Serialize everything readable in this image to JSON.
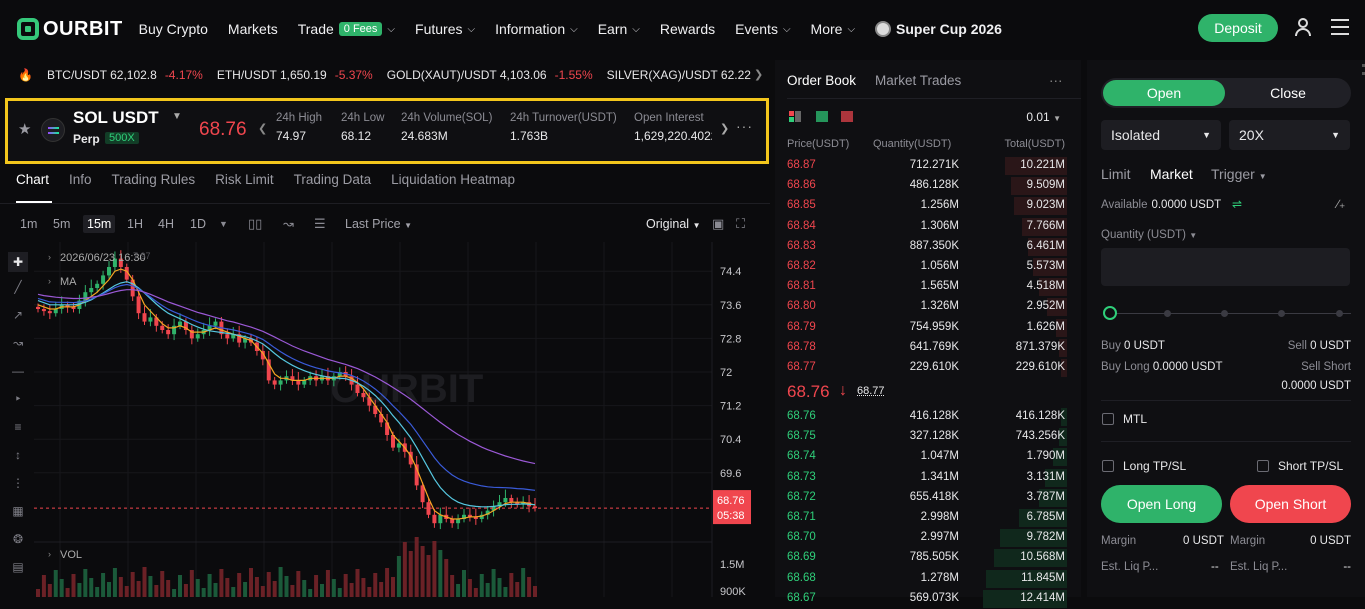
{
  "nav": {
    "brand": "OURBIT",
    "items": [
      "Buy Crypto",
      "Markets",
      "Trade",
      "Futures",
      "Information",
      "Earn",
      "Rewards",
      "Events",
      "More"
    ],
    "fees_badge": "0 Fees",
    "promo": "Super Cup 2026",
    "deposit": "Deposit"
  },
  "ticker": [
    {
      "pair": "BTC/USDT",
      "price": "62,102.8",
      "change": "-4.17%"
    },
    {
      "pair": "ETH/USDT",
      "price": "1,650.19",
      "change": "-5.37%"
    },
    {
      "pair": "GOLD(XAUT)/USDT",
      "price": "4,103.06",
      "change": "-1.55%"
    },
    {
      "pair": "SILVER(XAG)/USDT",
      "price": "62.22",
      "change": ""
    }
  ],
  "symbol": {
    "name": "SOL USDT",
    "type": "Perp",
    "leverage": "500X",
    "last": "68.76",
    "stats": [
      {
        "label": "24h High",
        "value": "74.97"
      },
      {
        "label": "24h Low",
        "value": "68.12"
      },
      {
        "label": "24h Volume(SOL)",
        "value": "24.683M"
      },
      {
        "label": "24h Turnover(USDT)",
        "value": "1.763B"
      },
      {
        "label": "Open Interest",
        "value": "1,629,220.4022"
      }
    ]
  },
  "chart_tabs": [
    "Chart",
    "Info",
    "Trading Rules",
    "Risk Limit",
    "Trading Data",
    "Liquidation Heatmap"
  ],
  "toolbar": {
    "timeframes": [
      "1m",
      "5m",
      "15m",
      "1H",
      "4H",
      "1D"
    ],
    "active_tf": "15m",
    "price_type": "Last Price",
    "view": "Original"
  },
  "chart_data": {
    "type": "candlestick",
    "timestamp_label": "2026/06/23 16:30",
    "timestamp_suffix": "7.97",
    "ma_label": "MA",
    "vol_label": "VOL",
    "price_ticks": [
      "74.4",
      "73.6",
      "72.8",
      "72",
      "71.2",
      "70.4",
      "69.6"
    ],
    "ylim": [
      68.0,
      75.0
    ],
    "vol_ticks": [
      "1.5M",
      "900K"
    ],
    "last_price": "68.76",
    "countdown": "05:38",
    "watermark": "OURBIT",
    "close_series": [
      73.5,
      73.45,
      73.4,
      73.5,
      73.6,
      73.55,
      73.5,
      73.7,
      73.9,
      74.0,
      74.1,
      74.3,
      74.5,
      74.7,
      74.5,
      74.2,
      73.8,
      73.4,
      73.2,
      73.3,
      73.1,
      73.0,
      72.9,
      73.1,
      73.2,
      73.0,
      72.8,
      72.9,
      73.0,
      73.1,
      73.2,
      72.9,
      72.8,
      72.9,
      72.7,
      72.8,
      72.7,
      72.5,
      72.3,
      71.8,
      71.7,
      71.8,
      71.9,
      71.8,
      71.7,
      71.8,
      71.9,
      71.8,
      71.9,
      71.8,
      71.9,
      72.0,
      71.9,
      71.7,
      71.5,
      71.4,
      71.2,
      71.0,
      70.8,
      70.5,
      70.2,
      70.3,
      70.1,
      69.8,
      69.3,
      68.9,
      68.6,
      68.4,
      68.6,
      68.5,
      68.4,
      68.5,
      68.6,
      68.55,
      68.5,
      68.6,
      68.7,
      68.8,
      68.9,
      69.0,
      68.9,
      68.85,
      68.9,
      68.8,
      68.76
    ],
    "ma_fast": [
      73.6,
      73.55,
      73.5,
      73.5,
      73.55,
      73.55,
      73.55,
      73.6,
      73.7,
      73.8,
      73.9,
      74.05,
      74.2,
      74.4,
      74.45,
      74.4,
      74.2,
      73.9,
      73.6,
      73.45,
      73.3,
      73.15,
      73.05,
      73.05,
      73.1,
      73.05,
      72.95,
      72.95,
      72.95,
      73.0,
      73.05,
      73.0,
      72.95,
      72.9,
      72.85,
      72.8,
      72.75,
      72.6,
      72.45,
      72.2,
      71.95,
      71.85,
      71.85,
      71.8,
      71.8,
      71.8,
      71.85,
      71.85,
      71.85,
      71.85,
      71.85,
      71.9,
      71.9,
      71.85,
      71.75,
      71.6,
      71.4,
      71.2,
      71.0,
      70.8,
      70.5,
      70.35,
      70.2,
      70.0,
      69.7,
      69.35,
      69.0,
      68.7,
      68.6,
      68.55,
      68.5,
      68.5,
      68.52,
      68.55,
      68.55,
      68.57,
      68.62,
      68.7,
      68.78,
      68.87,
      68.9,
      68.9,
      68.9,
      68.87,
      68.83
    ],
    "ma_mid": [
      73.7,
      73.65,
      73.6,
      73.6,
      73.6,
      73.6,
      73.6,
      73.62,
      73.66,
      73.72,
      73.8,
      73.88,
      73.97,
      74.06,
      74.12,
      74.15,
      74.1,
      74.0,
      73.88,
      73.75,
      73.62,
      73.5,
      73.4,
      73.33,
      73.27,
      73.2,
      73.13,
      73.07,
      73.02,
      72.98,
      72.96,
      72.94,
      72.92,
      72.9,
      72.87,
      72.84,
      72.8,
      72.74,
      72.67,
      72.56,
      72.44,
      72.33,
      72.24,
      72.16,
      72.09,
      72.03,
      71.98,
      71.94,
      71.91,
      71.88,
      71.86,
      71.85,
      71.84,
      71.8,
      71.74,
      71.66,
      71.56,
      71.44,
      71.3,
      71.14,
      70.96,
      70.8,
      70.62,
      70.43,
      70.2,
      69.95,
      69.7,
      69.45,
      69.25,
      69.1,
      68.98,
      68.9,
      68.85,
      68.82,
      68.8,
      68.79,
      68.79,
      68.8,
      68.82,
      68.84,
      68.85,
      68.85,
      68.86,
      68.85,
      68.84
    ],
    "ma_slow": [
      73.85,
      73.82,
      73.8,
      73.78,
      73.77,
      73.76,
      73.75,
      73.75,
      73.76,
      73.78,
      73.8,
      73.83,
      73.87,
      73.91,
      73.94,
      73.96,
      73.96,
      73.94,
      73.9,
      73.85,
      73.79,
      73.73,
      73.67,
      73.62,
      73.57,
      73.52,
      73.47,
      73.42,
      73.38,
      73.34,
      73.3,
      73.26,
      73.22,
      73.19,
      73.15,
      73.11,
      73.07,
      73.02,
      72.97,
      72.9,
      72.83,
      72.76,
      72.69,
      72.62,
      72.56,
      72.5,
      72.45,
      72.4,
      72.35,
      72.3,
      72.26,
      72.22,
      72.18,
      72.13,
      72.08,
      72.02,
      71.95,
      71.88,
      71.8,
      71.72,
      71.63,
      71.54,
      71.45,
      71.35,
      71.24,
      71.13,
      71.02,
      70.91,
      70.8,
      70.7,
      70.6,
      70.51,
      70.43,
      70.35,
      70.28,
      70.21,
      70.15,
      70.1,
      70.05,
      70.0,
      69.96,
      69.92,
      69.88,
      69.85,
      69.82
    ]
  },
  "orderbook": {
    "tabs": [
      "Order Book",
      "Market Trades"
    ],
    "precision": "0.01",
    "headers": [
      "Price(USDT)",
      "Quantity(USDT)",
      "Total(USDT)"
    ],
    "asks": [
      {
        "price": "68.87",
        "qty": "712.271K",
        "total": "10.221M",
        "depth": 0.22
      },
      {
        "price": "68.86",
        "qty": "486.128K",
        "total": "9.509M",
        "depth": 0.2
      },
      {
        "price": "68.85",
        "qty": "1.256M",
        "total": "9.023M",
        "depth": 0.19
      },
      {
        "price": "68.84",
        "qty": "1.306M",
        "total": "7.766M",
        "depth": 0.16
      },
      {
        "price": "68.83",
        "qty": "887.350K",
        "total": "6.461M",
        "depth": 0.14
      },
      {
        "price": "68.82",
        "qty": "1.056M",
        "total": "5.573M",
        "depth": 0.12
      },
      {
        "price": "68.81",
        "qty": "1.565M",
        "total": "4.518M",
        "depth": 0.1
      },
      {
        "price": "68.80",
        "qty": "1.326M",
        "total": "2.952M",
        "depth": 0.07
      },
      {
        "price": "68.79",
        "qty": "754.959K",
        "total": "1.626M",
        "depth": 0.04
      },
      {
        "price": "68.78",
        "qty": "641.769K",
        "total": "871.379K",
        "depth": 0.03
      },
      {
        "price": "68.77",
        "qty": "229.610K",
        "total": "229.610K",
        "depth": 0.02
      }
    ],
    "mid": "68.76",
    "mark": "68.77",
    "bids": [
      {
        "price": "68.76",
        "qty": "416.128K",
        "total": "416.128K",
        "depth": 0.02
      },
      {
        "price": "68.75",
        "qty": "327.128K",
        "total": "743.256K",
        "depth": 0.03
      },
      {
        "price": "68.74",
        "qty": "1.047M",
        "total": "1.790M",
        "depth": 0.05
      },
      {
        "price": "68.73",
        "qty": "1.341M",
        "total": "3.131M",
        "depth": 0.08
      },
      {
        "price": "68.72",
        "qty": "655.418K",
        "total": "3.787M",
        "depth": 0.1
      },
      {
        "price": "68.71",
        "qty": "2.998M",
        "total": "6.785M",
        "depth": 0.17
      },
      {
        "price": "68.70",
        "qty": "2.997M",
        "total": "9.782M",
        "depth": 0.24
      },
      {
        "price": "68.69",
        "qty": "785.505K",
        "total": "10.568M",
        "depth": 0.26
      },
      {
        "price": "68.68",
        "qty": "1.278M",
        "total": "11.845M",
        "depth": 0.29
      },
      {
        "price": "68.67",
        "qty": "569.073K",
        "total": "12.414M",
        "depth": 0.3
      }
    ]
  },
  "trade": {
    "open": "Open",
    "close": "Close",
    "margin_mode": "Isolated",
    "leverage": "20X",
    "order_types": [
      "Limit",
      "Market",
      "Trigger"
    ],
    "active_type": "Market",
    "available_label": "Available",
    "available": "0.0000 USDT",
    "qty_label": "Quantity (USDT)",
    "qty_value": "",
    "buy_label": "Buy",
    "buy_value": "0 USDT",
    "sell_label": "Sell",
    "sell_value": "0 USDT",
    "buy_long_label": "Buy Long",
    "buy_long_value": "0.0000 USDT",
    "sell_short_label": "Sell Short",
    "sell_short_value": "0.0000 USDT",
    "mtl": "MTL",
    "long_tpsl": "Long TP/SL",
    "short_tpsl": "Short TP/SL",
    "open_long": "Open Long",
    "open_short": "Open Short",
    "margin_label": "Margin",
    "margin_long": "0 USDT",
    "margin_short": "0 USDT",
    "liq_label": "Est. Liq P...",
    "liq_long": "--",
    "liq_short": "--"
  }
}
